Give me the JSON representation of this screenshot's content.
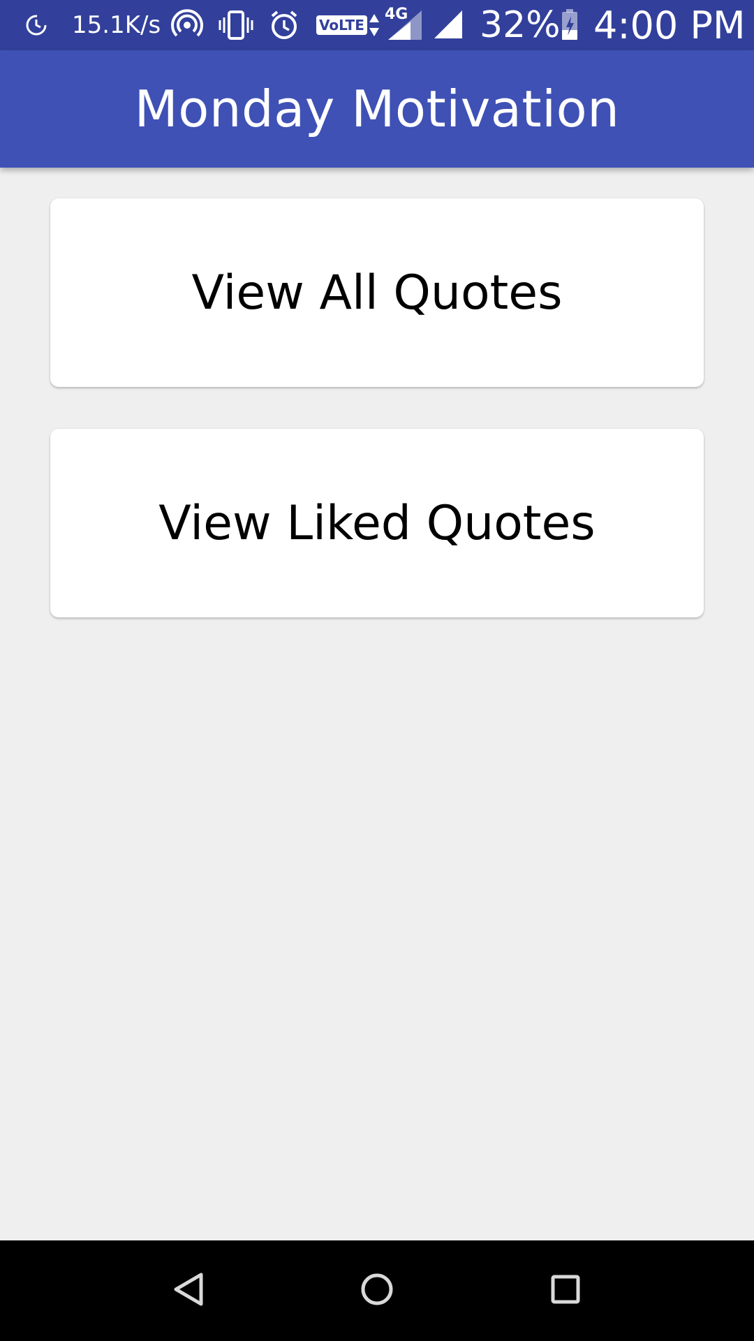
{
  "status_bar": {
    "net_speed": "15.1K/s",
    "volte": "VoLTE",
    "network": "4G",
    "battery": "32%",
    "time": "4:00 PM",
    "icons": [
      "sync-icon",
      "hotspot-icon",
      "vibrate-icon",
      "alarm-icon",
      "volte-icon",
      "data-arrows-icon",
      "signal-4g-icon",
      "signal-icon",
      "battery-charging-icon"
    ]
  },
  "app_bar": {
    "title": "Monday Motivation",
    "color": "#3f51b5"
  },
  "main": {
    "buttons": [
      {
        "label": "View All Quotes"
      },
      {
        "label": "View Liked Quotes"
      }
    ]
  },
  "nav_bar": {
    "icons": [
      "back-icon",
      "home-icon",
      "recents-icon"
    ]
  },
  "colors": {
    "status_bar": "#32409b",
    "app_bar": "#3f51b5",
    "background": "#efefef",
    "card": "#ffffff",
    "nav_bar": "#000000"
  }
}
